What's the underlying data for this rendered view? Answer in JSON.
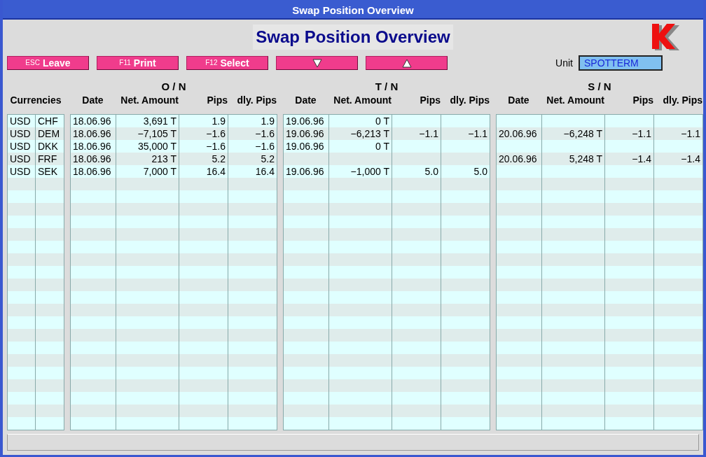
{
  "window": {
    "title": "Swap Position Overview"
  },
  "heading": "Swap Position Overview",
  "buttons": [
    {
      "kind": "text",
      "key": "ESC",
      "label": "Leave"
    },
    {
      "kind": "text",
      "key": "F11",
      "label": "Print"
    },
    {
      "kind": "text",
      "key": "F12",
      "label": "Select"
    },
    {
      "kind": "down"
    },
    {
      "kind": "up"
    }
  ],
  "unit": {
    "label": "Unit",
    "value": "SPOTTERM"
  },
  "currencies": {
    "header": "Currencies",
    "rows": [
      [
        "USD",
        "CHF"
      ],
      [
        "USD",
        "DEM"
      ],
      [
        "USD",
        "DKK"
      ],
      [
        "USD",
        "FRF"
      ],
      [
        "USD",
        "SEK"
      ]
    ]
  },
  "sections": [
    {
      "title": "O / N",
      "columns": [
        "Date",
        "Net. Amount",
        "Pips",
        "dly. Pips"
      ],
      "rows": [
        [
          "18.06.96",
          "3,691 T",
          "1.9",
          "1.9"
        ],
        [
          "18.06.96",
          "−7,105 T",
          "−1.6",
          "−1.6"
        ],
        [
          "18.06.96",
          "35,000 T",
          "−1.6",
          "−1.6"
        ],
        [
          "18.06.96",
          "213 T",
          "5.2",
          "5.2"
        ],
        [
          "18.06.96",
          "7,000 T",
          "16.4",
          "16.4"
        ]
      ]
    },
    {
      "title": "T / N",
      "columns": [
        "Date",
        "Net. Amount",
        "Pips",
        "dly. Pips"
      ],
      "rows": [
        [
          "19.06.96",
          "0 T",
          null,
          null
        ],
        [
          "19.06.96",
          "−6,213 T",
          "−1.1",
          "−1.1"
        ],
        [
          "19.06.96",
          "0 T",
          null,
          null
        ],
        null,
        [
          "19.06.96",
          "−1,000 T",
          "5.0",
          "5.0"
        ]
      ]
    },
    {
      "title": "S / N",
      "columns": [
        "Date",
        "Net. Amount",
        "Pips",
        "dly. Pips"
      ],
      "rows": [
        null,
        [
          "20.06.96",
          "−6,248 T",
          "−1.1",
          "−1.1"
        ],
        null,
        [
          "20.06.96",
          "5,248 T",
          "−1.4",
          "−1.4"
        ],
        null
      ]
    }
  ]
}
